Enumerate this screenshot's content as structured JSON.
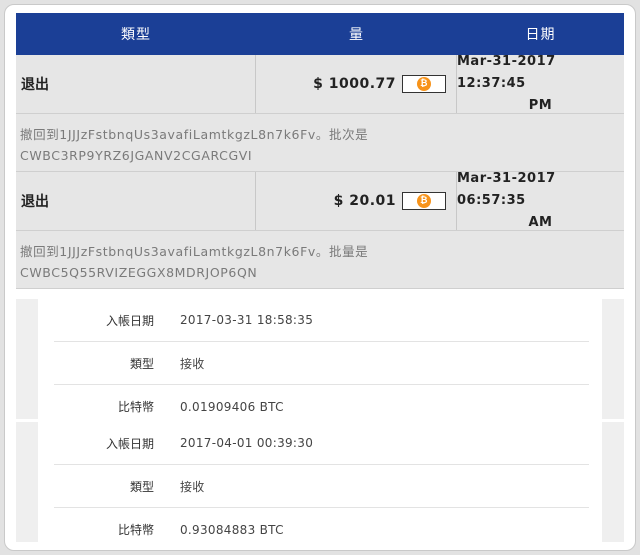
{
  "header": {
    "type": "類型",
    "amount": "量",
    "date": "日期"
  },
  "transactions": [
    {
      "type": "退出",
      "amount": "$ 1000.77",
      "coin_symbol": "₿",
      "date_line1": "Mar-31-2017 12:37:45",
      "date_line2": "PM",
      "note_line1": "撤回到1JJJzFstbnqUs3avafiLamtkgzL8n7k6Fv。批次是",
      "note_line2": "CWBC3RP9YRZ6JGANV2CGARCGVI"
    },
    {
      "type": "退出",
      "amount": "$ 20.01",
      "coin_symbol": "₿",
      "date_line1": "Mar-31-2017 06:57:35",
      "date_line2": "AM",
      "note_line1": "撤回到1JJJzFstbnqUs3avafiLamtkgzL8n7k6Fv。批量是",
      "note_line2": "CWBC5Q55RVIZEGGX8MDRJOP6QN"
    }
  ],
  "deposits": [
    {
      "date_label": "入帳日期",
      "date": "2017-03-31 18:58:35",
      "type_label": "類型",
      "type": "接收",
      "btc_label": "比特幣",
      "btc": "0.01909406 BTC"
    },
    {
      "date_label": "入帳日期",
      "date": "2017-04-01 00:39:30",
      "type_label": "類型",
      "type": "接收",
      "btc_label": "比特幣",
      "btc": "0.93084883 BTC"
    }
  ],
  "colors": {
    "header_bg": "#1b3f96",
    "row_bg": "#e6e6e6",
    "coin": "#f7931a"
  }
}
